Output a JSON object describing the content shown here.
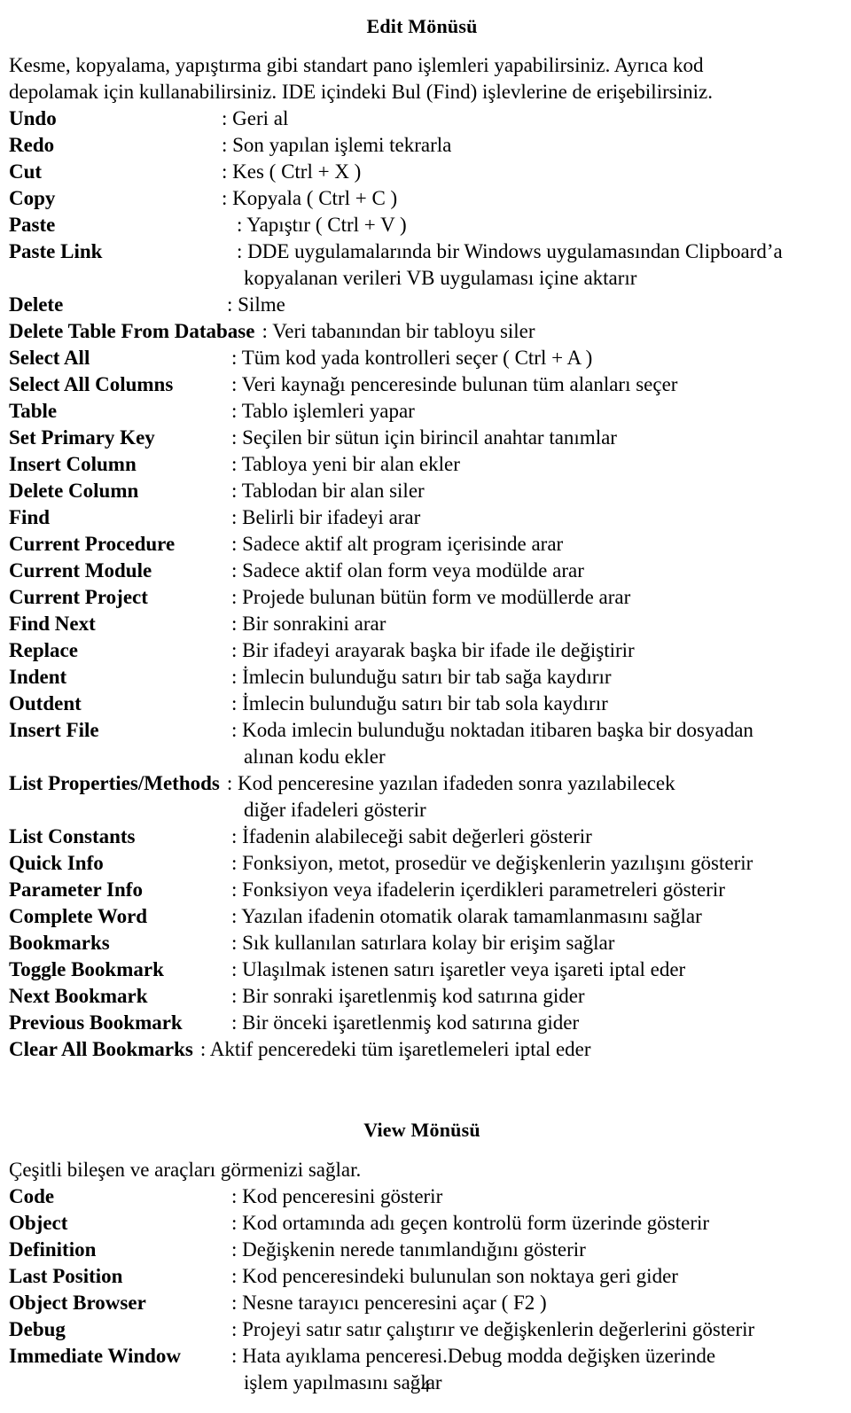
{
  "document": {
    "page_number": "4"
  },
  "edit_section": {
    "title": "Edit Mönüsü",
    "intro_line1": "Kesme, kopyalama, yapıştırma gibi standart pano işlemleri yapabilirsiniz. Ayrıca kod",
    "intro_line2": "depolamak için kullanabilirsiniz. IDE içindeki Bul (Find) işlevlerine de erişebilirsiniz.",
    "entries": [
      {
        "term": "Undo",
        "desc": ": Geri al"
      },
      {
        "term": "Redo",
        "desc": ": Son yapılan işlemi tekrarla"
      },
      {
        "term": "Cut",
        "desc": ": Kes ( Ctrl + X )"
      },
      {
        "term": "Copy",
        "desc": ": Kopyala ( Ctrl + C )"
      },
      {
        "term": "Paste",
        "desc": ": Yapıştır ( Ctrl + V )"
      },
      {
        "term": "Paste Link",
        "desc": ": DDE uygulamalarında bir Windows uygulamasından Clipboard’a",
        "cont": "kopyalanan verileri VB uygulaması içine aktarır"
      },
      {
        "term": "Delete",
        "desc": ": Silme"
      },
      {
        "term": "Delete Table From Database",
        "desc": ": Veri tabanından bir tabloyu siler"
      },
      {
        "term": "Select All",
        "desc": ": Tüm kod yada kontrolleri seçer  ( Ctrl + A )"
      },
      {
        "term": "Select All Columns",
        "desc": ": Veri kaynağı penceresinde bulunan tüm alanları seçer"
      },
      {
        "term": "Table",
        "desc": ": Tablo işlemleri yapar"
      },
      {
        "term": "Set Primary Key",
        "desc": ": Seçilen bir sütun için birincil anahtar tanımlar"
      },
      {
        "term": "Insert Column",
        "desc": ": Tabloya yeni bir alan ekler"
      },
      {
        "term": "Delete Column",
        "desc": ": Tablodan bir alan siler"
      },
      {
        "term": "Find",
        "desc": ": Belirli bir ifadeyi arar"
      },
      {
        "term": "Current Procedure",
        "desc": ": Sadece aktif alt program içerisinde arar"
      },
      {
        "term": "Current Module",
        "desc": ": Sadece aktif olan form veya modülde arar"
      },
      {
        "term": "Current Project",
        "desc": ": Projede bulunan bütün form ve modüllerde arar"
      },
      {
        "term": "Find Next",
        "desc": ": Bir sonrakini arar"
      },
      {
        "term": "Replace",
        "desc": ": Bir ifadeyi arayarak başka bir ifade ile değiştirir"
      },
      {
        "term": "Indent",
        "desc": ": İmlecin bulunduğu satırı bir tab sağa kaydırır"
      },
      {
        "term": "Outdent",
        "desc": ": İmlecin bulunduğu satırı  bir tab sola kaydırır"
      },
      {
        "term": "Insert File",
        "desc": ": Koda imlecin bulunduğu noktadan itibaren başka bir dosyadan",
        "cont": "alınan kodu ekler"
      },
      {
        "term": "List Properties/Methods",
        "desc": ": Kod penceresine yazılan ifadeden sonra yazılabilecek",
        "cont": "diğer ifadeleri gösterir"
      },
      {
        "term": "List Constants",
        "desc": ": İfadenin alabileceği sabit değerleri gösterir"
      },
      {
        "term": "Quick Info",
        "desc": ": Fonksiyon, metot, prosedür ve değişkenlerin yazılışını gösterir"
      },
      {
        "term": "Parameter Info",
        "desc": ": Fonksiyon veya ifadelerin içerdikleri parametreleri gösterir"
      },
      {
        "term": "Complete Word",
        "desc": ": Yazılan ifadenin otomatik olarak tamamlanmasını sağlar"
      },
      {
        "term": "Bookmarks",
        "desc": ": Sık kullanılan satırlara kolay bir erişim sağlar"
      },
      {
        "term": "Toggle Bookmark",
        "desc": ": Ulaşılmak istenen satırı işaretler veya işareti iptal eder"
      },
      {
        "term": "Next Bookmark",
        "desc": ": Bir sonraki işaretlenmiş kod satırına gider"
      },
      {
        "term": "Previous Bookmark",
        "desc": ": Bir önceki işaretlenmiş kod satırına gider"
      },
      {
        "term": "Clear All Bookmarks",
        "desc": ": Aktif penceredeki tüm işaretlemeleri iptal eder"
      }
    ]
  },
  "view_section": {
    "title": "View Mönüsü",
    "intro_line1": "Çeşitli bileşen ve araçları görmenizi sağlar.",
    "entries": [
      {
        "term": "Code",
        "desc": ": Kod penceresini gösterir"
      },
      {
        "term": "Object",
        "desc": ": Kod ortamında adı geçen kontrolü form üzerinde gösterir"
      },
      {
        "term": "Definition",
        "desc": ": Değişkenin nerede tanımlandığını gösterir"
      },
      {
        "term": "Last Position",
        "desc": ": Kod penceresindeki bulunulan son noktaya geri gider"
      },
      {
        "term": "Object Browser",
        "desc": ": Nesne tarayıcı penceresini açar ( F2 )"
      },
      {
        "term": "Debug",
        "desc": ": Projeyi satır satır çalıştırır ve değişkenlerin değerlerini gösterir"
      },
      {
        "term": "Immediate Window",
        "desc": ": Hata ayıklama penceresi.Debug modda değişken üzerinde",
        "cont": "işlem yapılmasını sağlar"
      }
    ]
  }
}
